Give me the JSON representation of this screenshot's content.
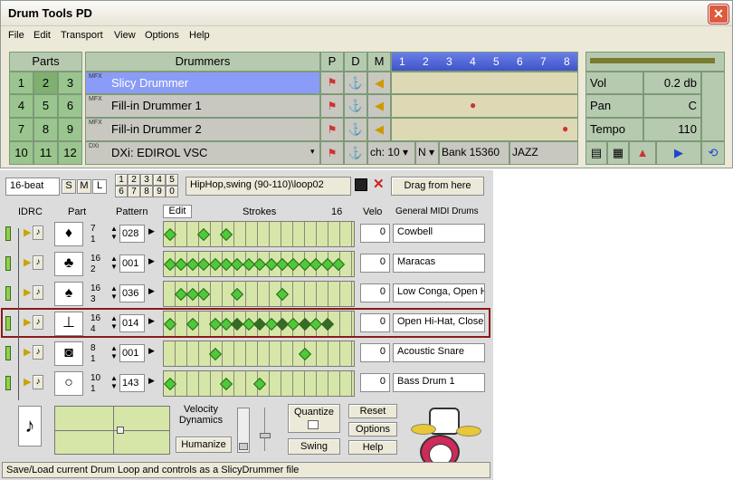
{
  "window": {
    "title": "Drum Tools PD",
    "close": "✕"
  },
  "menu": [
    "File",
    "Edit",
    "Transport",
    "View",
    "Options",
    "Help"
  ],
  "parts": {
    "header": "Parts",
    "nums": [
      "1",
      "2",
      "3",
      "4",
      "5",
      "6",
      "7",
      "8",
      "9",
      "10",
      "11",
      "12"
    ]
  },
  "drummers": {
    "header": "Drummers",
    "col_p": "P",
    "col_d": "D",
    "col_m": "M",
    "beats": [
      "1",
      "2",
      "3",
      "4",
      "5",
      "6",
      "7",
      "8"
    ],
    "rows": [
      {
        "badge": "MFX",
        "name": "Slicy Drummer"
      },
      {
        "badge": "MFX",
        "name": "Fill-in Drummer 1"
      },
      {
        "badge": "MFX",
        "name": "Fill-in Drummer 2"
      },
      {
        "badge": "DXi",
        "name": "DXi: EDIROL VSC"
      }
    ]
  },
  "synth": {
    "channel": "ch: 10",
    "n": "N",
    "bank": "Bank 15360",
    "kit": "JAZZ"
  },
  "right": {
    "vol_label": "Vol",
    "vol": "0.2 db",
    "pan_label": "Pan",
    "pan": "C",
    "tempo_label": "Tempo",
    "tempo": "110"
  },
  "toolbar": {
    "style": "16-beat",
    "s": "S",
    "m": "M",
    "l": "L",
    "grid": [
      "1",
      "2",
      "3",
      "4",
      "5",
      "6",
      "7",
      "8",
      "9",
      "0"
    ],
    "loop": "HipHop,swing (90-110)\\loop02",
    "drag": "Drag from here"
  },
  "cols": {
    "idrc": "IDRC",
    "part": "Part",
    "pattern": "Pattern",
    "edit": "Edit",
    "strokes": "Strokes",
    "res": "16",
    "velo": "Velo",
    "gm": "General MIDI Drums"
  },
  "tracks": [
    {
      "top": "7",
      "bot": "1",
      "pattern": "028",
      "velo": "0",
      "instrument": "Cowbell",
      "hits": [
        0,
        3,
        5
      ]
    },
    {
      "top": "16",
      "bot": "2",
      "pattern": "001",
      "velo": "0",
      "instrument": "Maracas",
      "hits": [
        0,
        1,
        2,
        3,
        4,
        5,
        6,
        7,
        8,
        9,
        10,
        11,
        12,
        13,
        14,
        15
      ]
    },
    {
      "top": "16",
      "bot": "3",
      "pattern": "036",
      "velo": "0",
      "instrument": "Low Conga, Open H",
      "hits": [
        1,
        2,
        3,
        6,
        10
      ]
    },
    {
      "top": "16",
      "bot": "4",
      "pattern": "014",
      "velo": "0",
      "instrument": "Open Hi-Hat, Close",
      "hits": [
        0,
        2,
        4,
        5,
        6,
        7,
        8,
        9,
        10,
        11,
        12,
        13,
        14
      ]
    },
    {
      "top": "8",
      "bot": "1",
      "pattern": "001",
      "velo": "0",
      "instrument": "Acoustic Snare",
      "hits": [
        4,
        12
      ]
    },
    {
      "top": "10",
      "bot": "1",
      "pattern": "143",
      "velo": "0",
      "instrument": "Bass Drum 1",
      "hits": [
        0,
        5,
        8
      ]
    }
  ],
  "controls": {
    "velocity": "Velocity Dynamics",
    "humanize": "Humanize",
    "quantize": "Quantize",
    "swing": "Swing",
    "reset": "Reset",
    "options": "Options",
    "help": "Help"
  },
  "status": "Save/Load current Drum Loop and controls as a SlicyDrummer file"
}
